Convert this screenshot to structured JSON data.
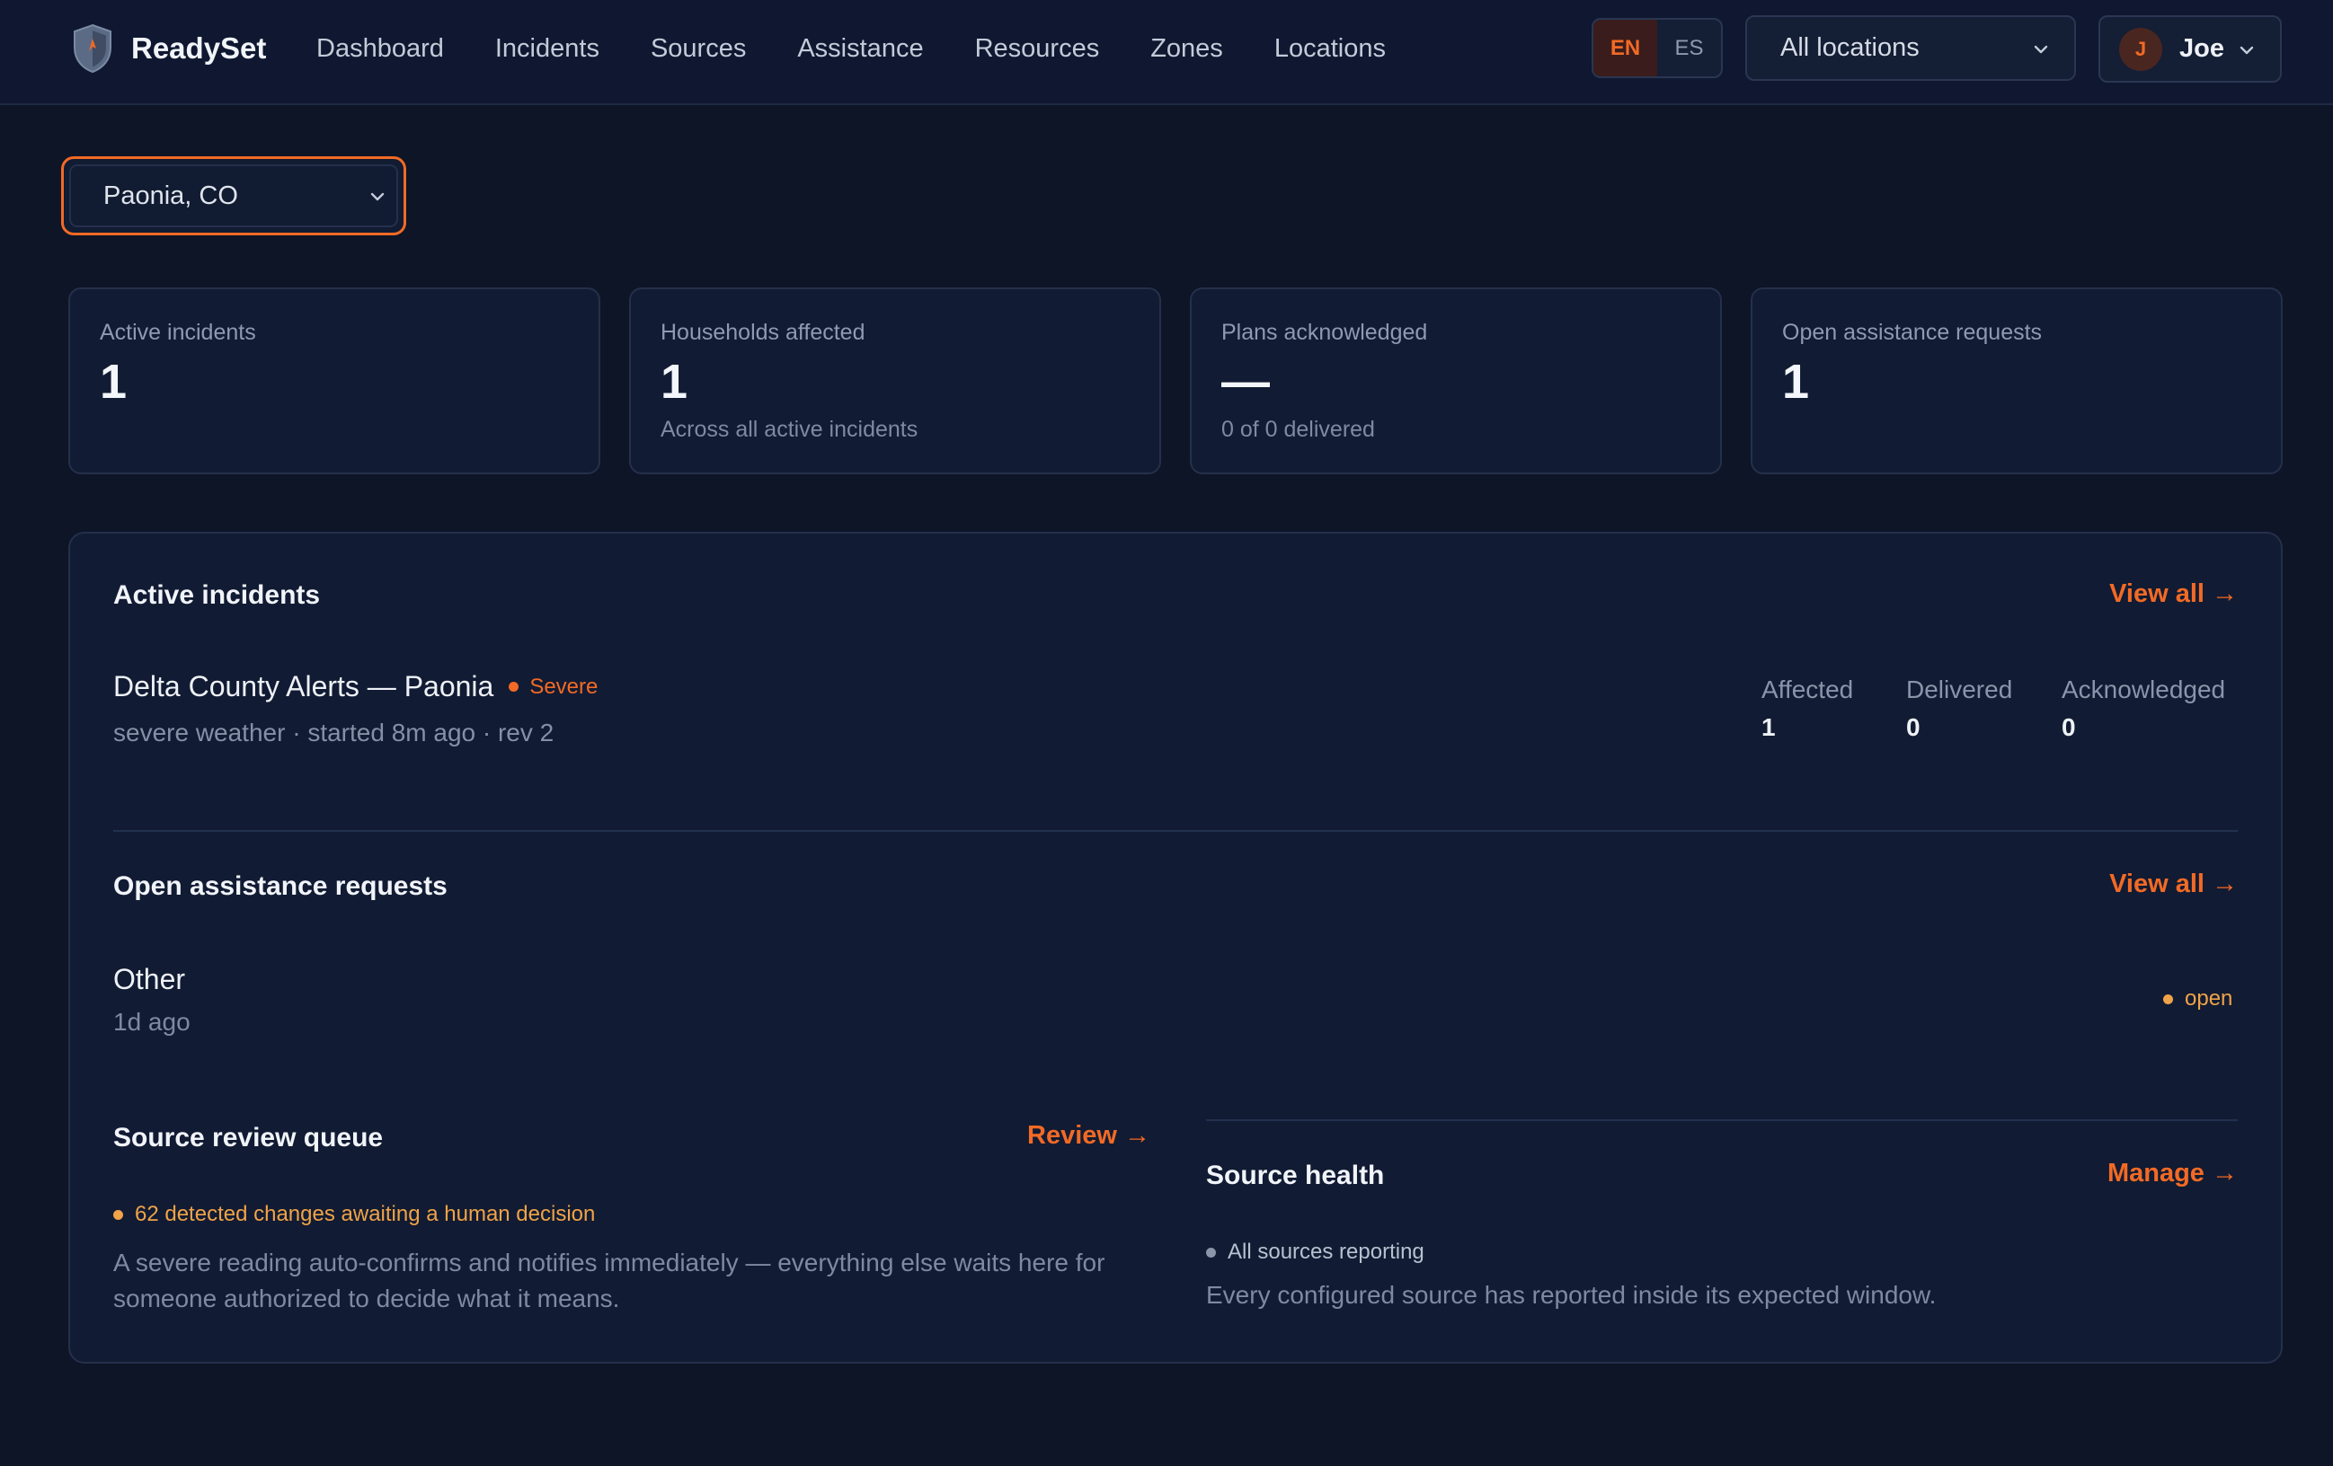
{
  "header": {
    "brand": "ReadySet",
    "nav": [
      "Dashboard",
      "Incidents",
      "Sources",
      "Assistance",
      "Resources",
      "Zones",
      "Locations"
    ],
    "lang": {
      "en": "EN",
      "es": "ES",
      "active": "EN"
    },
    "location_filter": "All locations",
    "user": {
      "initial": "J",
      "name": "Joe"
    }
  },
  "location_select": {
    "value": "Paonia, CO"
  },
  "stats": [
    {
      "label": "Active incidents",
      "value": "1",
      "sub": ""
    },
    {
      "label": "Households affected",
      "value": "1",
      "sub": "Across all active incidents"
    },
    {
      "label": "Plans acknowledged",
      "value": "—",
      "sub": "0 of 0 delivered"
    },
    {
      "label": "Open assistance requests",
      "value": "1",
      "sub": ""
    }
  ],
  "active_incidents": {
    "title": "Active incidents",
    "view_all": "View all →",
    "items": [
      {
        "name": "Delta County Alerts — Paonia",
        "severity": "Severe",
        "meta": "severe weather · started 8m ago · rev 2",
        "affected_label": "Affected",
        "affected": "1",
        "delivered_label": "Delivered",
        "delivered": "0",
        "acknowledged_label": "Acknowledged",
        "acknowledged": "0"
      }
    ]
  },
  "assistance": {
    "title": "Open assistance requests",
    "view_all": "View all →",
    "items": [
      {
        "title": "Other",
        "time": "1d ago",
        "status": "open"
      }
    ]
  },
  "review_queue": {
    "title": "Source review queue",
    "action": "Review →",
    "note": "62 detected changes awaiting a human decision",
    "description": "A severe reading auto-confirms and notifies immediately — everything else waits here for someone authorized to decide what it means."
  },
  "source_health": {
    "title": "Source health",
    "action": "Manage →",
    "note": "All sources reporting",
    "description": "Every configured source has reported inside its expected window."
  },
  "colors": {
    "accent": "#f26a25",
    "warning": "#f0a347",
    "background": "#0d1527",
    "panel": "#111b33"
  }
}
